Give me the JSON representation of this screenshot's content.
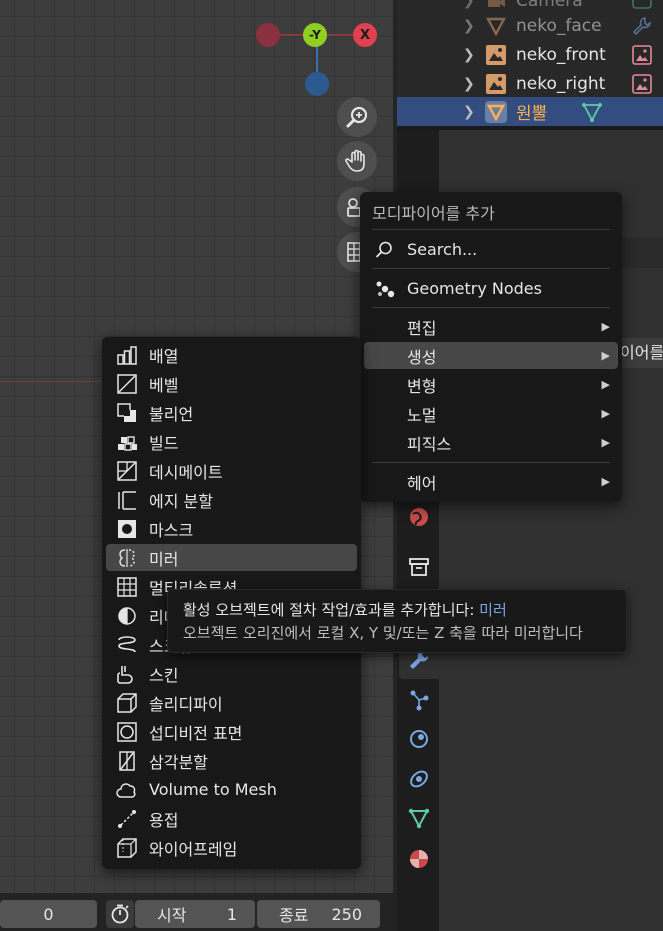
{
  "viewport": {
    "gizmo": {
      "neg_y_label": "-Y",
      "x_label": "X"
    }
  },
  "outliner": {
    "rows": [
      {
        "label": "Camera"
      },
      {
        "label": "neko_face"
      },
      {
        "label": "neko_front"
      },
      {
        "label": "neko_right"
      },
      {
        "label": "원뿔"
      }
    ]
  },
  "properties": {
    "partial_header": "이어를"
  },
  "add_menu": {
    "title": "모디파이어를 추가",
    "search_label": "Search...",
    "geometry_nodes_label": "Geometry Nodes",
    "categories": [
      {
        "label": "편집"
      },
      {
        "label": "생성"
      },
      {
        "label": "변형"
      },
      {
        "label": "노멀"
      },
      {
        "label": "피직스"
      },
      {
        "label": "헤어"
      }
    ]
  },
  "generate_menu": {
    "items": [
      {
        "label": "배열"
      },
      {
        "label": "베벨"
      },
      {
        "label": "불리언"
      },
      {
        "label": "빌드"
      },
      {
        "label": "데시메이트"
      },
      {
        "label": "에지 분할"
      },
      {
        "label": "마스크"
      },
      {
        "label": "미러"
      },
      {
        "label": "멀티리솔루션"
      },
      {
        "label": "리메시"
      },
      {
        "label": "스크류"
      },
      {
        "label": "스킨"
      },
      {
        "label": "솔리디파이"
      },
      {
        "label": "섭디비전 표면"
      },
      {
        "label": "삼각분할"
      },
      {
        "label": "Volume to Mesh"
      },
      {
        "label": "용접"
      },
      {
        "label": "와이어프레임"
      }
    ]
  },
  "tooltip": {
    "line1_prefix": "활성 오브젝트에 절차 작업/효과를 추가합니다: ",
    "line1_highlight": "미러",
    "line2": "오브젝트 오리진에서 로컬 X, Y 및/또는 Z 축을 따라 미러합니다"
  },
  "timeline": {
    "current_frame": "0",
    "start_label": "시작",
    "start_value": "1",
    "end_label": "종료",
    "end_value": "250"
  },
  "colors": {
    "highlight_text": "#7aa6e6",
    "selected_row": "#334d80",
    "selected_label": "#ffb14d"
  }
}
